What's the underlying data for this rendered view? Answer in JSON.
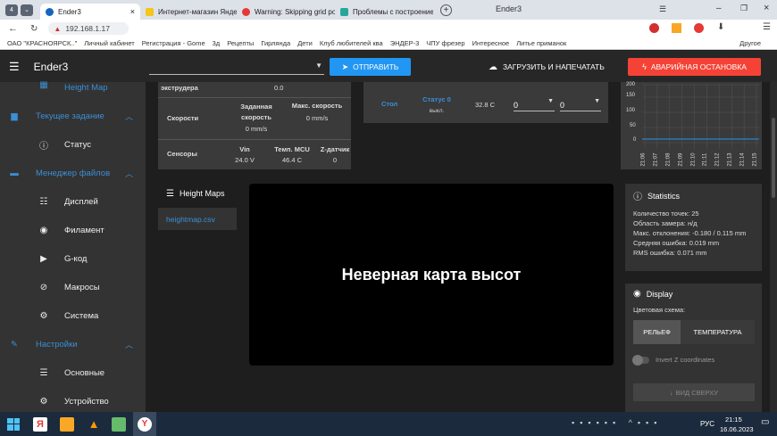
{
  "browser": {
    "tabs": [
      {
        "label": "Ender3",
        "active": true,
        "color": "#1565c0"
      },
      {
        "label": "Интернет-магазин Яндекс",
        "color": "#f5c518"
      },
      {
        "label": "Warning: Skipping grid po...",
        "color": "#e53935"
      },
      {
        "label": "Проблемы с построением",
        "color": "#26a69a"
      }
    ],
    "window_title": "Ender3",
    "url": "192.168.1.17",
    "bookmarks": [
      "ОАО \"КРАСНОЯРСК..\"",
      "Личный кабинет",
      "Регистрация - Gome",
      "3д",
      "Рецепты",
      "Гирлянда",
      "Дети",
      "Клуб любителей ква",
      "ЭНДЕР-3",
      "ЧПУ фрезер",
      "Интересное",
      "Литье приманок",
      "Другое"
    ]
  },
  "app": {
    "title": "Ender3",
    "send_label": "ОТПРАВИТЬ",
    "upload_label": "ЗАГРУЗИТЬ И НАПЕЧАТАТЬ",
    "emergency_label": "АВАРИЙНАЯ ОСТАНОВКА"
  },
  "sidebar": {
    "top_item": "Height Map",
    "current_job": "Текущее задание",
    "status": "Статус",
    "file_manager": "Менеджер файлов",
    "display": "Дисплей",
    "filament": "Филамент",
    "gcode": "G-код",
    "macros": "Макросы",
    "system": "Система",
    "settings": "Настройки",
    "general": "Основные",
    "device": "Устройство"
  },
  "machine": {
    "extruder_label": "экструдера",
    "extruder_value": "0.0",
    "speeds_label": "Скорости",
    "req_speed_label": "Заданная скорость",
    "req_speed_value": "0 mm/s",
    "max_speed_label": "Макс. скорость",
    "max_speed_value": "0 mm/s",
    "sensors_label": "Сенсоры",
    "vin_label": "Vin",
    "vin_value": "24.0 V",
    "mcu_label": "Темп. MCU",
    "mcu_value": "46.4 C",
    "zprobe_label": "Z-датчик",
    "zprobe_value": "0"
  },
  "heater": {
    "name": "Стол",
    "status_label": "Статус 0",
    "status_value": "выкл.",
    "current_temp": "32.8 C",
    "active_temp": "0",
    "standby_temp": "0"
  },
  "temp_chart": {
    "y_top": "200",
    "y_labels": [
      "150",
      "100",
      "50",
      "0"
    ],
    "x_labels": [
      "21:06",
      "21:07",
      "21:08",
      "21:09",
      "21:10",
      "21:11",
      "21:12",
      "21:13",
      "21:14",
      "21:15"
    ]
  },
  "heightmaps": {
    "title": "Height Maps",
    "file": "heightmap.csv",
    "error": "Неверная карта высот"
  },
  "statistics": {
    "title": "Statistics",
    "points": "Количество точек: 25",
    "area": "Область замера: н/д",
    "deviation": "Макс. отклонения: -0.180 / 0.115 mm",
    "mean": "Средняя ошибка: 0.019 mm",
    "rms": "RMS ошибка: 0.071 mm"
  },
  "display": {
    "title": "Display",
    "scheme_label": "Цветовая схема:",
    "relief": "РЕЛЬЕФ",
    "temperature": "ТЕМПЕРАТУРА",
    "invert_label": "Invert Z coordinates",
    "top_view": "ВИД СВЕРХУ"
  },
  "taskbar": {
    "lang": "РУС",
    "time": "21:15",
    "date": "16.06.2023"
  }
}
